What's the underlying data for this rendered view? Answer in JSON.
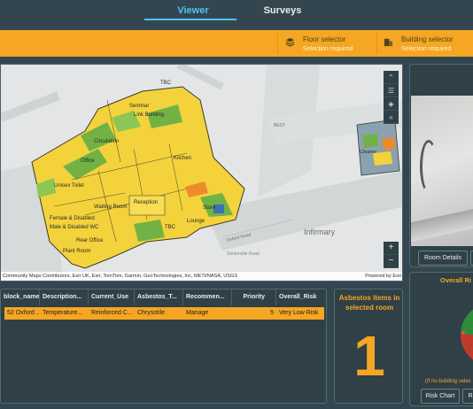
{
  "nav": {
    "tabs": [
      {
        "label": "Viewer",
        "active": true
      },
      {
        "label": "Surveys",
        "active": false
      }
    ]
  },
  "selectors": {
    "floor": {
      "label": "Floor selector",
      "status": "Selection required"
    },
    "building": {
      "label": "Building selector",
      "status": "Selection required"
    }
  },
  "map": {
    "labels": [
      "TBC",
      "Seminar",
      "Link Building",
      "Circulation",
      "Office",
      "Kitchen",
      "Reception",
      "Waiting Room",
      "Unisex Toilet",
      "Female & Disabled",
      "Male & Disabled WC",
      "Rear Office",
      "Plant Room",
      "Lounge",
      "TBC",
      "Store",
      "Infirmary",
      "Cleaner",
      "BEST",
      "Somerville Road",
      "Oxford Road"
    ],
    "attribution": "Community Maps Contributors, Esri UK, Esri, TomTom, Garmin, GeoTechnologies, Inc, METI/NASA, USGS",
    "powered_by": "Powered by Esri",
    "zoom_in": "+",
    "zoom_out": "−"
  },
  "table": {
    "headers": [
      "block_name",
      "Description...",
      "Current_Use",
      "Asbestos_T...",
      "Recommen...",
      "Priority",
      "Overall_Risk"
    ],
    "rows": [
      [
        "52 Oxford ...",
        "Temperature...",
        "Reinforced C...",
        "Chrysotile",
        "Manage",
        "5",
        "Very Low Risk"
      ]
    ]
  },
  "counter": {
    "title": "Asbestos items in selected room",
    "value": "1"
  },
  "photo_panel": {
    "buttons": [
      "Room Details",
      ""
    ]
  },
  "risk_panel": {
    "title": "Overall Ri",
    "note": "(If no building selec",
    "buttons": [
      "Risk Chart",
      "R"
    ]
  },
  "colors": {
    "accent": "#f5a623",
    "tab_active": "#4fc3f7",
    "panel": "#2f4047",
    "bg": "#33464f"
  }
}
